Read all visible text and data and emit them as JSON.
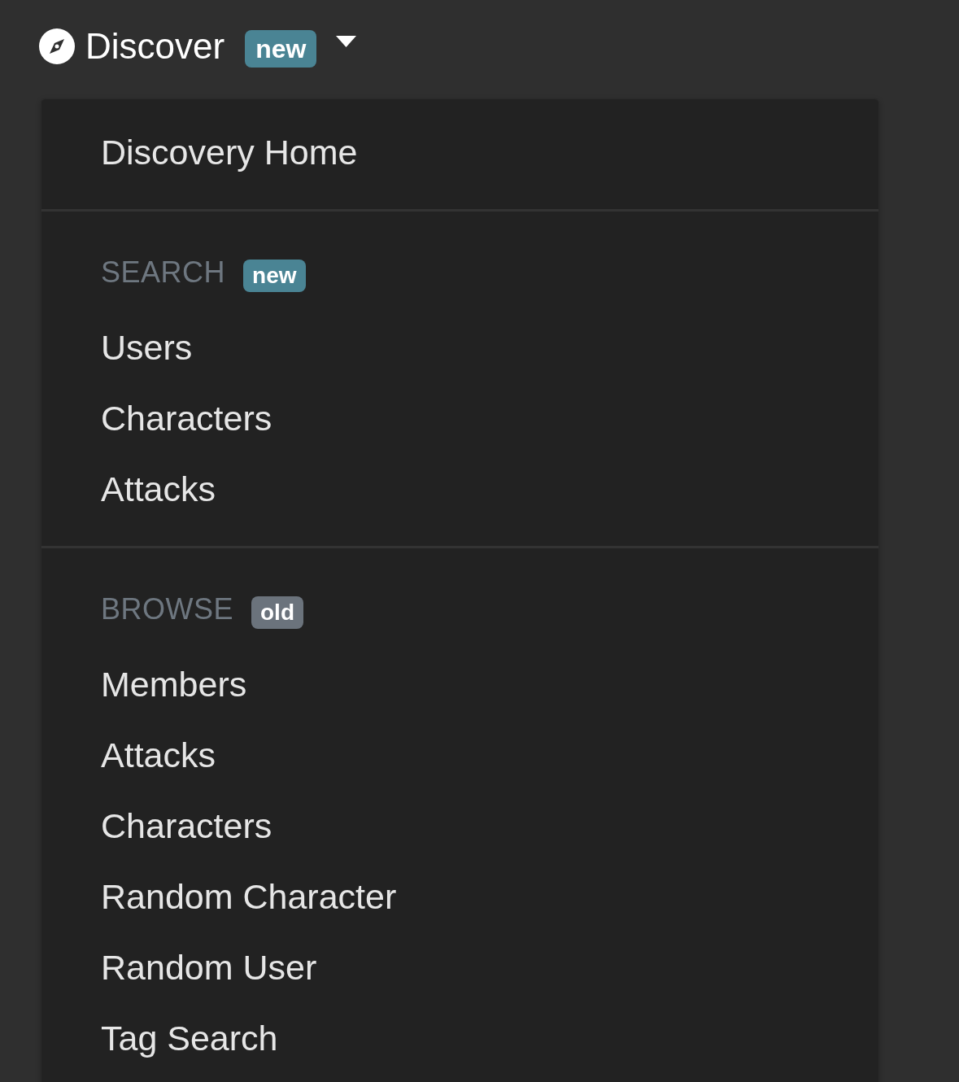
{
  "nav": {
    "label": "Discover",
    "badge": {
      "text": "new",
      "kind": "new"
    },
    "expanded": true
  },
  "menu": {
    "sections": [
      {
        "items": [
          {
            "label": "Discovery Home"
          }
        ]
      },
      {
        "header": "SEARCH",
        "badge": {
          "text": "new",
          "kind": "new"
        },
        "items": [
          {
            "label": "Users"
          },
          {
            "label": "Characters"
          },
          {
            "label": "Attacks"
          }
        ]
      },
      {
        "header": "BROWSE",
        "badge": {
          "text": "old",
          "kind": "old"
        },
        "items": [
          {
            "label": "Members"
          },
          {
            "label": "Attacks"
          },
          {
            "label": "Characters"
          },
          {
            "label": "Random Character"
          },
          {
            "label": "Random User"
          },
          {
            "label": "Tag Search"
          }
        ]
      }
    ]
  }
}
